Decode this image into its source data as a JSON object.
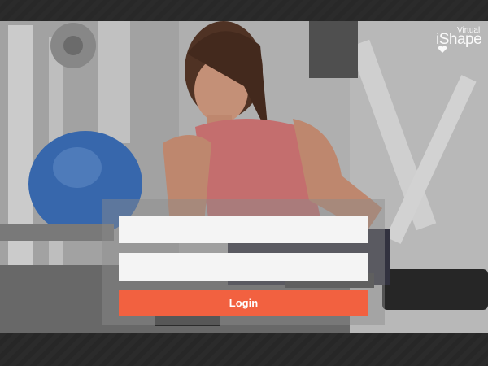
{
  "brand": {
    "superscript": "Virtual",
    "name": "iShape"
  },
  "login": {
    "username_placeholder": "",
    "password_placeholder": "",
    "button_label": "Login"
  },
  "colors": {
    "accent": "#f26140",
    "field_bg": "#f4f4f4",
    "frame": "#2a2a2a"
  },
  "icons": {
    "logo_heart": "heart-icon"
  }
}
